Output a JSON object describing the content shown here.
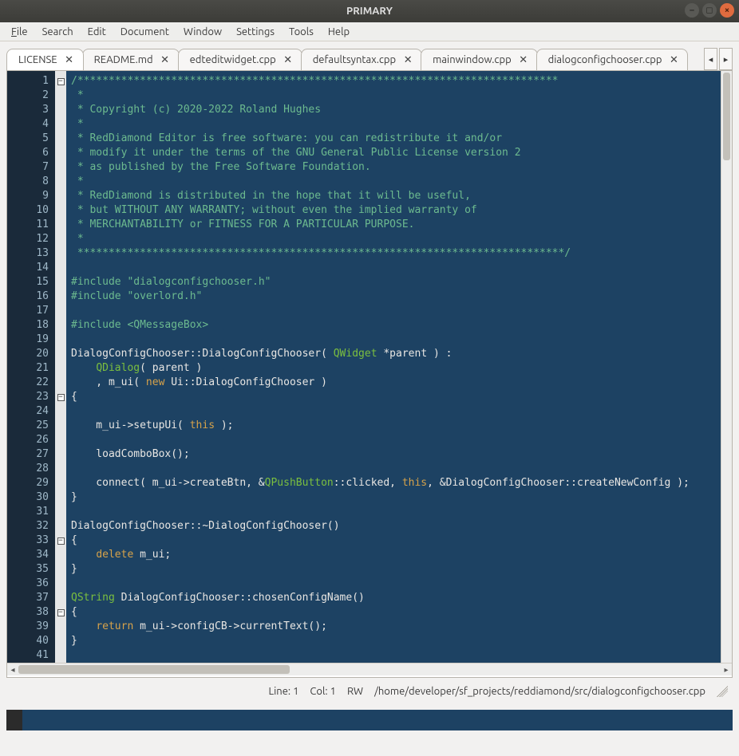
{
  "window": {
    "title": "PRIMARY"
  },
  "menus": {
    "file": {
      "label": "File",
      "accel_index": 0
    },
    "search": {
      "label": "Search"
    },
    "edit": {
      "label": "Edit"
    },
    "document": {
      "label": "Document"
    },
    "window": {
      "label": "Window"
    },
    "settings": {
      "label": "Settings"
    },
    "tools": {
      "label": "Tools"
    },
    "help": {
      "label": "Help"
    }
  },
  "tabs": [
    {
      "label": "LICENSE",
      "active": true
    },
    {
      "label": "README.md",
      "active": false
    },
    {
      "label": "edteditwidget.cpp",
      "active": false
    },
    {
      "label": "defaultsyntax.cpp",
      "active": false
    },
    {
      "label": "mainwindow.cpp",
      "active": false
    },
    {
      "label": "dialogconfigchooser.cpp",
      "active": false
    }
  ],
  "editor": {
    "line_count": 41,
    "lines": [
      {
        "html": "<span class='cmt'>/*****************************************************************************</span>"
      },
      {
        "html": "<span class='cmt'> *</span>"
      },
      {
        "html": "<span class='cmt'> * Copyright (c) 2020-2022 Roland Hughes</span>"
      },
      {
        "html": "<span class='cmt'> *</span>"
      },
      {
        "html": "<span class='cmt'> * RedDiamond Editor is free software: you can redistribute it and/or</span>"
      },
      {
        "html": "<span class='cmt'> * modify it under the terms of the GNU General Public License version 2</span>"
      },
      {
        "html": "<span class='cmt'> * as published by the Free Software Foundation.</span>"
      },
      {
        "html": "<span class='cmt'> *</span>"
      },
      {
        "html": "<span class='cmt'> * RedDiamond is distributed in the hope that it will be useful,</span>"
      },
      {
        "html": "<span class='cmt'> * but WITHOUT ANY WARRANTY; without even the implied warranty of</span>"
      },
      {
        "html": "<span class='cmt'> * MERCHANTABILITY or FITNESS FOR A PARTICULAR PURPOSE.</span>"
      },
      {
        "html": "<span class='cmt'> *</span>"
      },
      {
        "html": "<span class='cmt'> ******************************************************************************/</span>"
      },
      {
        "html": ""
      },
      {
        "html": "<span class='prep'>#include</span> <span class='str'>\"dialogconfigchooser.h\"</span>"
      },
      {
        "html": "<span class='prep'>#include</span> <span class='str'>\"overlord.h\"</span>"
      },
      {
        "html": ""
      },
      {
        "html": "<span class='prep'>#include</span> <span class='str'>&lt;QMessageBox&gt;</span>"
      },
      {
        "html": ""
      },
      {
        "html": "DialogConfigChooser::DialogConfigChooser( <span class='type'>QWidget</span> *parent ) :"
      },
      {
        "html": "    <span class='type'>QDialog</span>( parent )"
      },
      {
        "html": "    , m_ui( <span class='kw'>new</span> Ui::DialogConfigChooser )"
      },
      {
        "html": "{"
      },
      {
        "html": ""
      },
      {
        "html": "    m_ui-&gt;setupUi( <span class='this'>this</span> );"
      },
      {
        "html": ""
      },
      {
        "html": "    loadComboBox();"
      },
      {
        "html": ""
      },
      {
        "html": "    connect( m_ui-&gt;createBtn, &amp;<span class='type'>QPushButton</span>::clicked, <span class='this'>this</span>, &amp;DialogConfigChooser::createNewConfig );"
      },
      {
        "html": "}"
      },
      {
        "html": ""
      },
      {
        "html": "DialogConfigChooser::~DialogConfigChooser()"
      },
      {
        "html": "{"
      },
      {
        "html": "    <span class='kw'>delete</span> m_ui;"
      },
      {
        "html": "}"
      },
      {
        "html": ""
      },
      {
        "html": "<span class='type'>QString</span> DialogConfigChooser::chosenConfigName()"
      },
      {
        "html": "{"
      },
      {
        "html": "    <span class='kw'>return</span> m_ui-&gt;configCB-&gt;currentText();"
      },
      {
        "html": "}"
      },
      {
        "html": ""
      }
    ],
    "fold_markers": {
      "1": "minus",
      "23": "minus",
      "33": "minus",
      "38": "minus"
    }
  },
  "status": {
    "line_label": "Line:",
    "line_value": "1",
    "col_label": "Col:",
    "col_value": "1",
    "mode": "RW",
    "path": "/home/developer/sf_projects/reddiamond/src/dialogconfigchooser.cpp"
  }
}
